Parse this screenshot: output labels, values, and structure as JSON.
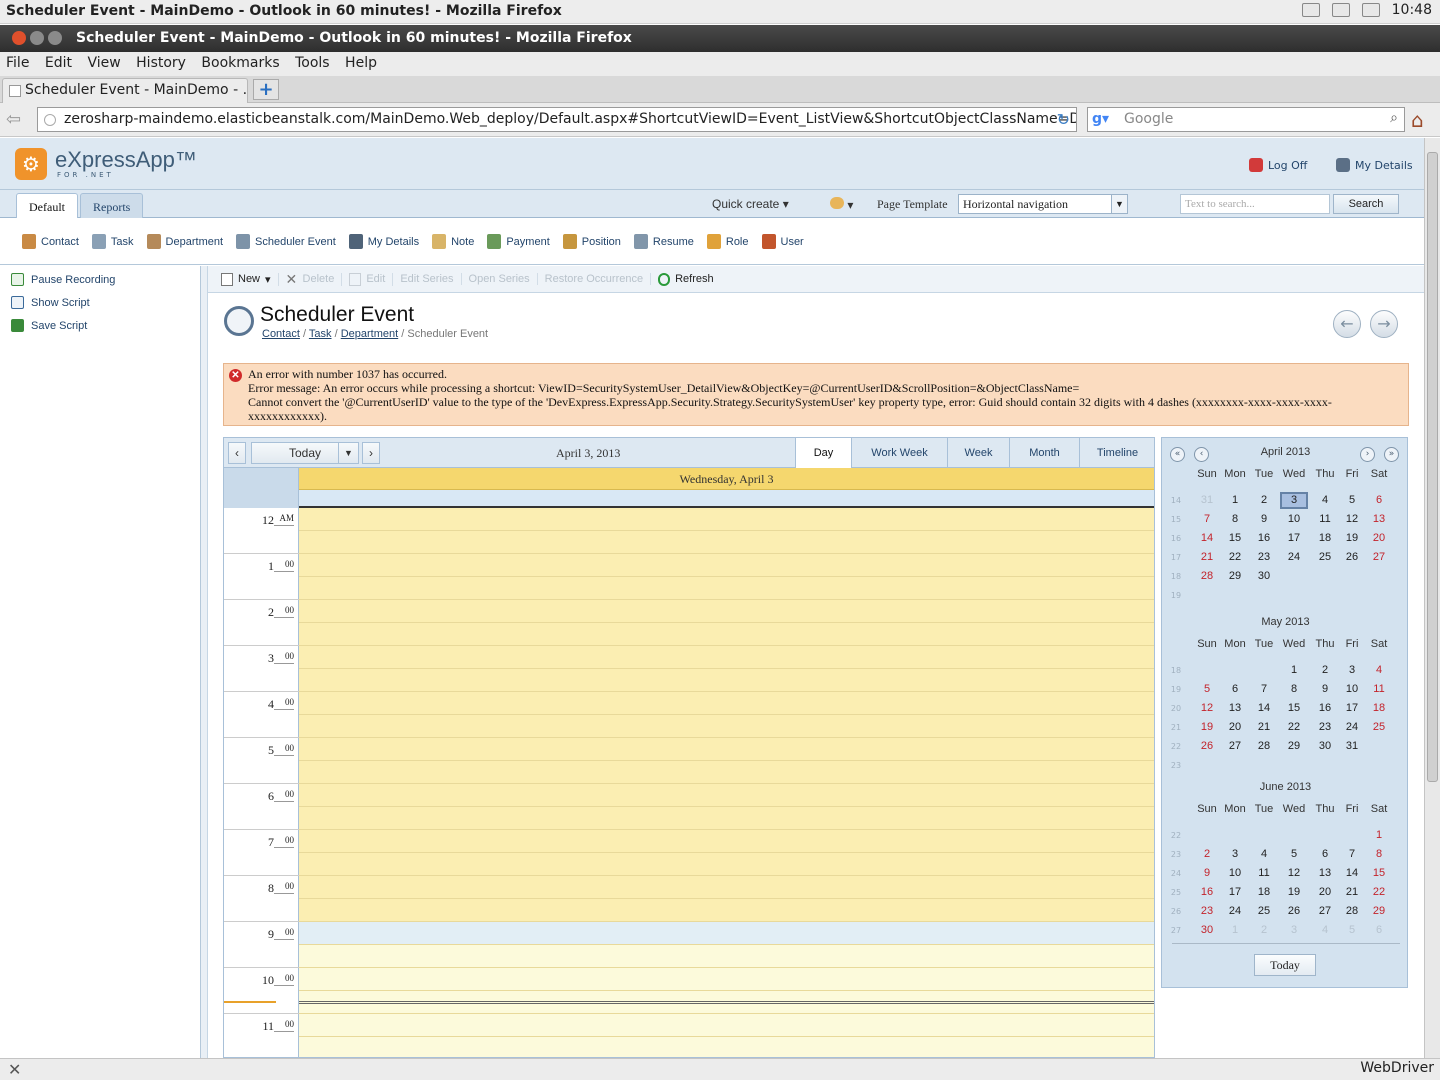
{
  "os": {
    "title": "Scheduler Event - MainDemo - Outlook in 60 minutes! - Mozilla Firefox",
    "clock": "10:48"
  },
  "window": {
    "title": "Scheduler Event - MainDemo - Outlook in 60 minutes! - Mozilla Firefox"
  },
  "menu": [
    "File",
    "Edit",
    "View",
    "History",
    "Bookmarks",
    "Tools",
    "Help"
  ],
  "browser_tab": {
    "label": "Scheduler Event - MainDemo - ...",
    "new_tab": "+"
  },
  "address": {
    "url": "zerosharp-maindemo.elasticbeanstalk.com/MainDemo.Web_deploy/Default.aspx#ShortcutViewID=Event_ListView&ShortcutObjectClassName=De",
    "search_placeholder": "Google"
  },
  "app": {
    "logo_text": "eXpressApp™",
    "logo_sub": "FOR .NET",
    "logoff": "Log Off",
    "my_details": "My Details",
    "tabs": [
      "Default",
      "Reports"
    ],
    "quick_create": "Quick create",
    "page_template_label": "Page Template",
    "page_template_value": "Horizontal navigation",
    "search_placeholder": "Text to search...",
    "search_button": "Search",
    "nav_items": [
      "Contact",
      "Task",
      "Department",
      "Scheduler Event",
      "My Details",
      "Note",
      "Payment",
      "Position",
      "Resume",
      "Role",
      "User"
    ],
    "left_items": [
      "Pause Recording",
      "Show Script",
      "Save Script"
    ],
    "toolbar": {
      "new": "New",
      "delete": "Delete",
      "edit": "Edit",
      "edit_series": "Edit Series",
      "open_series": "Open Series",
      "restore": "Restore Occurrence",
      "refresh": "Refresh"
    },
    "page_title": "Scheduler Event",
    "breadcrumb": {
      "contact": "Contact",
      "task": "Task",
      "department": "Department",
      "current": "Scheduler Event",
      "sep": "/"
    },
    "error": {
      "line1": "An error with number 1037 has occurred.",
      "line2": "Error message: An error occurs while processing a shortcut: ViewID=SecuritySystemUser_DetailView&ObjectKey=@CurrentUserID&ScrollPosition=&ObjectClassName=",
      "line3": "Cannot convert the '@CurrentUserID' value to the type of the 'DevExpress.ExpressApp.Security.Strategy.SecuritySystemUser' key property type, error: Guid should contain 32 digits with 4 dashes (xxxxxxxx-xxxx-xxxx-xxxx-xxxxxxxxxxxx)."
    }
  },
  "scheduler": {
    "today_label": "Today",
    "date_label": "April 3, 2013",
    "views": [
      "Day",
      "Work Week",
      "Week",
      "Month",
      "Timeline"
    ],
    "active_view": "Day",
    "day_header": "Wednesday, April 3",
    "hours": [
      {
        "h": "12",
        "m": "AM"
      },
      {
        "h": "1",
        "m": "00"
      },
      {
        "h": "2",
        "m": "00"
      },
      {
        "h": "3",
        "m": "00"
      },
      {
        "h": "4",
        "m": "00"
      },
      {
        "h": "5",
        "m": "00"
      },
      {
        "h": "6",
        "m": "00"
      },
      {
        "h": "7",
        "m": "00"
      },
      {
        "h": "8",
        "m": "00"
      },
      {
        "h": "9",
        "m": "00"
      },
      {
        "h": "10",
        "m": "00"
      },
      {
        "h": "11",
        "m": "00"
      }
    ],
    "colors": {
      "work_hours": "#fbeeb2",
      "off_hours": "#fcfadb",
      "highlight": "#e2eef5"
    }
  },
  "calendar": {
    "dow": [
      "Sun",
      "Mon",
      "Tue",
      "Wed",
      "Thu",
      "Fri",
      "Sat"
    ],
    "today_button": "Today",
    "nav": {
      "prev_year": "«",
      "prev": "‹",
      "next": "›",
      "next_year": "»"
    },
    "months": [
      {
        "title": "April 2013",
        "weeks": [
          "14",
          "15",
          "16",
          "17",
          "18",
          "19"
        ],
        "days": [
          [
            "31",
            "1",
            "2",
            "3",
            "4",
            "5",
            "6"
          ],
          [
            "7",
            "8",
            "9",
            "10",
            "11",
            "12",
            "13"
          ],
          [
            "14",
            "15",
            "16",
            "17",
            "18",
            "19",
            "20"
          ],
          [
            "21",
            "22",
            "23",
            "24",
            "25",
            "26",
            "27"
          ],
          [
            "28",
            "29",
            "30",
            "",
            "",
            "",
            ""
          ],
          [
            "",
            "",
            "",
            "",
            "",
            "",
            ""
          ]
        ],
        "first": 1,
        "last": 30,
        "selected": "3"
      },
      {
        "title": "May 2013",
        "weeks": [
          "18",
          "19",
          "20",
          "21",
          "22",
          "23"
        ],
        "days": [
          [
            "",
            "",
            "",
            "1",
            "2",
            "3",
            "4"
          ],
          [
            "5",
            "6",
            "7",
            "8",
            "9",
            "10",
            "11"
          ],
          [
            "12",
            "13",
            "14",
            "15",
            "16",
            "17",
            "18"
          ],
          [
            "19",
            "20",
            "21",
            "22",
            "23",
            "24",
            "25"
          ],
          [
            "26",
            "27",
            "28",
            "29",
            "30",
            "31",
            ""
          ],
          [
            "",
            "",
            "",
            "",
            "",
            "",
            ""
          ]
        ],
        "first": 3,
        "last": 33,
        "selected": ""
      },
      {
        "title": "June 2013",
        "weeks": [
          "22",
          "23",
          "24",
          "25",
          "26",
          "27"
        ],
        "days": [
          [
            "",
            "",
            "",
            "",
            "",
            "",
            "1"
          ],
          [
            "2",
            "3",
            "4",
            "5",
            "6",
            "7",
            "8"
          ],
          [
            "9",
            "10",
            "11",
            "12",
            "13",
            "14",
            "15"
          ],
          [
            "16",
            "17",
            "18",
            "19",
            "20",
            "21",
            "22"
          ],
          [
            "23",
            "24",
            "25",
            "26",
            "27",
            "28",
            "29"
          ],
          [
            "30",
            "1",
            "2",
            "3",
            "4",
            "5",
            "6"
          ]
        ],
        "first": 6,
        "last": 35,
        "selected": ""
      }
    ]
  },
  "status": {
    "right": "WebDriver"
  }
}
